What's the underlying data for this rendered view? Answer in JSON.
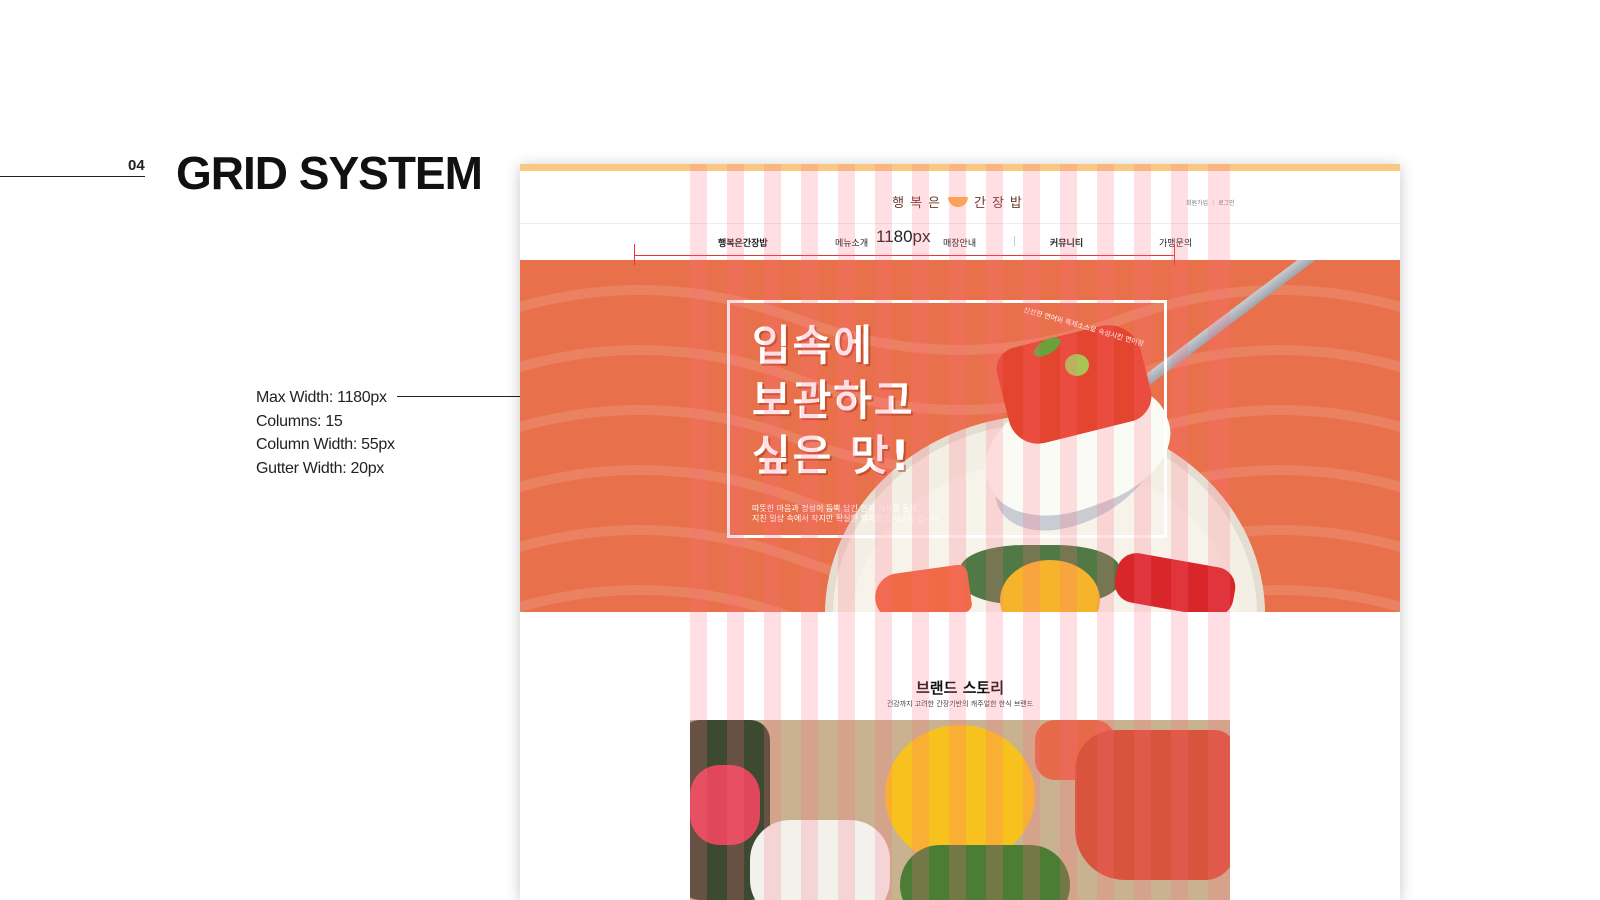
{
  "section": {
    "number": "04",
    "title": "GRID SYSTEM"
  },
  "specs": [
    "Max Width: 1180px",
    "Columns: 15",
    "Column Width: 55px",
    "Gutter Width: 20px"
  ],
  "mockup": {
    "logo_left": "행복은",
    "logo_right": "간장밥",
    "util_links": [
      "회원가입",
      "로그인"
    ],
    "nav": [
      "행복은간장밥",
      "메뉴소개",
      "매장안내",
      "커뮤니티",
      "가맹문의"
    ],
    "dimension_label": "1180px",
    "hero": {
      "title_lines": [
        "입속에",
        "보관하고",
        "싶은 맛!"
      ],
      "description_lines": [
        "따뜻한 마음과 정성이 듬뿍 담긴 한끼 식사를 통해",
        "지친 일상 속에서 작지만 확실한 행복을 드리고자 합니다."
      ],
      "arc_text": "신선한 연어와 특제소스로 숙성시킨 연어장"
    },
    "brand": {
      "title": "브랜드 스토리",
      "subtitle": "건강까지 고려한 간장기반의 캐주얼한 한식 브랜드"
    }
  },
  "colors": {
    "accent_bar": "#f8c982",
    "hero_bg": "#e8704a",
    "grid_column": "rgba(255,110,130,0.22)",
    "dimension": "#e33"
  }
}
